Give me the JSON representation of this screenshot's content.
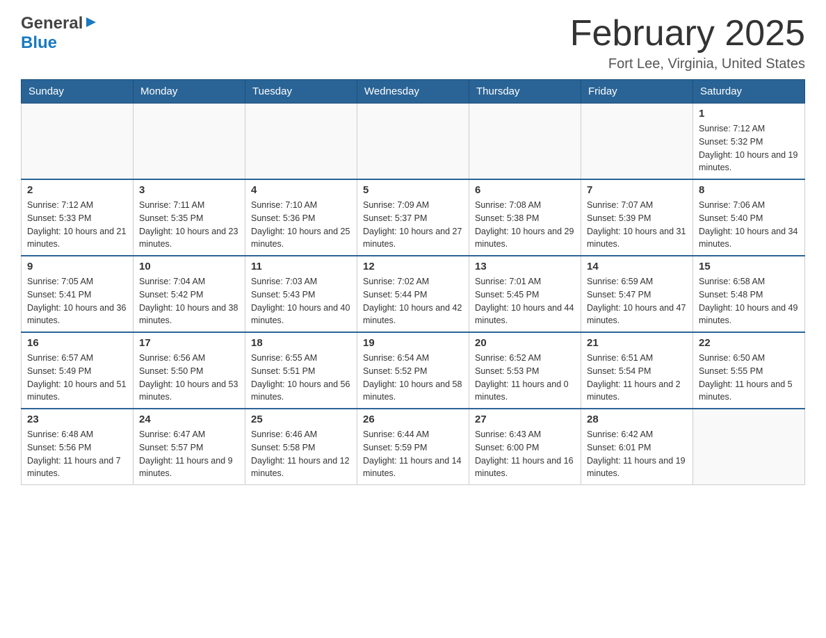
{
  "header": {
    "logo_general": "General",
    "logo_blue": "Blue",
    "month_year": "February 2025",
    "location": "Fort Lee, Virginia, United States"
  },
  "days_of_week": [
    "Sunday",
    "Monday",
    "Tuesday",
    "Wednesday",
    "Thursday",
    "Friday",
    "Saturday"
  ],
  "weeks": [
    [
      {
        "day": "",
        "sunrise": "",
        "sunset": "",
        "daylight": ""
      },
      {
        "day": "",
        "sunrise": "",
        "sunset": "",
        "daylight": ""
      },
      {
        "day": "",
        "sunrise": "",
        "sunset": "",
        "daylight": ""
      },
      {
        "day": "",
        "sunrise": "",
        "sunset": "",
        "daylight": ""
      },
      {
        "day": "",
        "sunrise": "",
        "sunset": "",
        "daylight": ""
      },
      {
        "day": "",
        "sunrise": "",
        "sunset": "",
        "daylight": ""
      },
      {
        "day": "1",
        "sunrise": "Sunrise: 7:12 AM",
        "sunset": "Sunset: 5:32 PM",
        "daylight": "Daylight: 10 hours and 19 minutes."
      }
    ],
    [
      {
        "day": "2",
        "sunrise": "Sunrise: 7:12 AM",
        "sunset": "Sunset: 5:33 PM",
        "daylight": "Daylight: 10 hours and 21 minutes."
      },
      {
        "day": "3",
        "sunrise": "Sunrise: 7:11 AM",
        "sunset": "Sunset: 5:35 PM",
        "daylight": "Daylight: 10 hours and 23 minutes."
      },
      {
        "day": "4",
        "sunrise": "Sunrise: 7:10 AM",
        "sunset": "Sunset: 5:36 PM",
        "daylight": "Daylight: 10 hours and 25 minutes."
      },
      {
        "day": "5",
        "sunrise": "Sunrise: 7:09 AM",
        "sunset": "Sunset: 5:37 PM",
        "daylight": "Daylight: 10 hours and 27 minutes."
      },
      {
        "day": "6",
        "sunrise": "Sunrise: 7:08 AM",
        "sunset": "Sunset: 5:38 PM",
        "daylight": "Daylight: 10 hours and 29 minutes."
      },
      {
        "day": "7",
        "sunrise": "Sunrise: 7:07 AM",
        "sunset": "Sunset: 5:39 PM",
        "daylight": "Daylight: 10 hours and 31 minutes."
      },
      {
        "day": "8",
        "sunrise": "Sunrise: 7:06 AM",
        "sunset": "Sunset: 5:40 PM",
        "daylight": "Daylight: 10 hours and 34 minutes."
      }
    ],
    [
      {
        "day": "9",
        "sunrise": "Sunrise: 7:05 AM",
        "sunset": "Sunset: 5:41 PM",
        "daylight": "Daylight: 10 hours and 36 minutes."
      },
      {
        "day": "10",
        "sunrise": "Sunrise: 7:04 AM",
        "sunset": "Sunset: 5:42 PM",
        "daylight": "Daylight: 10 hours and 38 minutes."
      },
      {
        "day": "11",
        "sunrise": "Sunrise: 7:03 AM",
        "sunset": "Sunset: 5:43 PM",
        "daylight": "Daylight: 10 hours and 40 minutes."
      },
      {
        "day": "12",
        "sunrise": "Sunrise: 7:02 AM",
        "sunset": "Sunset: 5:44 PM",
        "daylight": "Daylight: 10 hours and 42 minutes."
      },
      {
        "day": "13",
        "sunrise": "Sunrise: 7:01 AM",
        "sunset": "Sunset: 5:45 PM",
        "daylight": "Daylight: 10 hours and 44 minutes."
      },
      {
        "day": "14",
        "sunrise": "Sunrise: 6:59 AM",
        "sunset": "Sunset: 5:47 PM",
        "daylight": "Daylight: 10 hours and 47 minutes."
      },
      {
        "day": "15",
        "sunrise": "Sunrise: 6:58 AM",
        "sunset": "Sunset: 5:48 PM",
        "daylight": "Daylight: 10 hours and 49 minutes."
      }
    ],
    [
      {
        "day": "16",
        "sunrise": "Sunrise: 6:57 AM",
        "sunset": "Sunset: 5:49 PM",
        "daylight": "Daylight: 10 hours and 51 minutes."
      },
      {
        "day": "17",
        "sunrise": "Sunrise: 6:56 AM",
        "sunset": "Sunset: 5:50 PM",
        "daylight": "Daylight: 10 hours and 53 minutes."
      },
      {
        "day": "18",
        "sunrise": "Sunrise: 6:55 AM",
        "sunset": "Sunset: 5:51 PM",
        "daylight": "Daylight: 10 hours and 56 minutes."
      },
      {
        "day": "19",
        "sunrise": "Sunrise: 6:54 AM",
        "sunset": "Sunset: 5:52 PM",
        "daylight": "Daylight: 10 hours and 58 minutes."
      },
      {
        "day": "20",
        "sunrise": "Sunrise: 6:52 AM",
        "sunset": "Sunset: 5:53 PM",
        "daylight": "Daylight: 11 hours and 0 minutes."
      },
      {
        "day": "21",
        "sunrise": "Sunrise: 6:51 AM",
        "sunset": "Sunset: 5:54 PM",
        "daylight": "Daylight: 11 hours and 2 minutes."
      },
      {
        "day": "22",
        "sunrise": "Sunrise: 6:50 AM",
        "sunset": "Sunset: 5:55 PM",
        "daylight": "Daylight: 11 hours and 5 minutes."
      }
    ],
    [
      {
        "day": "23",
        "sunrise": "Sunrise: 6:48 AM",
        "sunset": "Sunset: 5:56 PM",
        "daylight": "Daylight: 11 hours and 7 minutes."
      },
      {
        "day": "24",
        "sunrise": "Sunrise: 6:47 AM",
        "sunset": "Sunset: 5:57 PM",
        "daylight": "Daylight: 11 hours and 9 minutes."
      },
      {
        "day": "25",
        "sunrise": "Sunrise: 6:46 AM",
        "sunset": "Sunset: 5:58 PM",
        "daylight": "Daylight: 11 hours and 12 minutes."
      },
      {
        "day": "26",
        "sunrise": "Sunrise: 6:44 AM",
        "sunset": "Sunset: 5:59 PM",
        "daylight": "Daylight: 11 hours and 14 minutes."
      },
      {
        "day": "27",
        "sunrise": "Sunrise: 6:43 AM",
        "sunset": "Sunset: 6:00 PM",
        "daylight": "Daylight: 11 hours and 16 minutes."
      },
      {
        "day": "28",
        "sunrise": "Sunrise: 6:42 AM",
        "sunset": "Sunset: 6:01 PM",
        "daylight": "Daylight: 11 hours and 19 minutes."
      },
      {
        "day": "",
        "sunrise": "",
        "sunset": "",
        "daylight": ""
      }
    ]
  ]
}
